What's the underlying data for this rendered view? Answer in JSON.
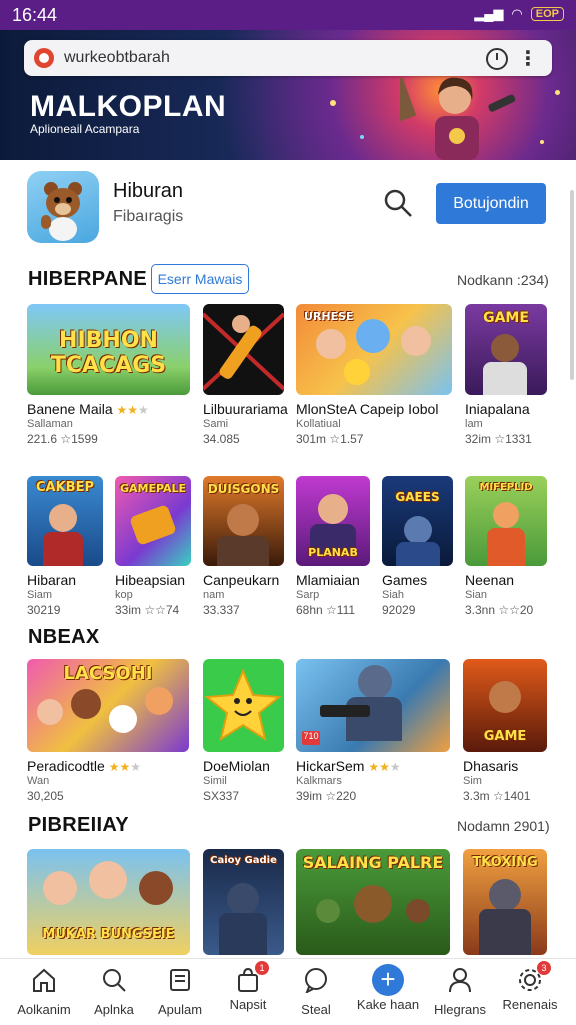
{
  "status": {
    "time": "16:44",
    "battery": "EOP"
  },
  "browser": {
    "url": "wurkeobtbarah"
  },
  "hero": {
    "brand": "MALKOPLAN",
    "tagline": "Aplioneail Acampara"
  },
  "app": {
    "title": "Hiburan",
    "subtitle": "Fibaıragis",
    "button_label": "Botujondin"
  },
  "sections": [
    {
      "title": "HIBERPANE",
      "chip": "Eserr Mawais",
      "more": "Nodkann :234)",
      "cards": [
        {
          "name": "Banene Maila",
          "dev": "Sallaman",
          "meta": "221.6 ☆1599",
          "stars": 2,
          "thumb_text": "HIBHON TCACAGS"
        },
        {
          "name": "Lilbuurariama",
          "dev": "Sami",
          "meta": "34.085",
          "stars": 0,
          "thumb_text": ""
        },
        {
          "name": "MlonSteA Capeip Iobol",
          "dev": "Kollatiual",
          "meta": "301m ☆1.57",
          "stars": 0,
          "thumb_text": "URHESE"
        },
        {
          "name": "Iniapalana",
          "dev": "lam",
          "meta": "32im ☆1331",
          "stars": 0,
          "thumb_text": "GAME"
        }
      ]
    },
    {
      "title": "",
      "chip": "",
      "more": "",
      "cards": [
        {
          "name": "Hibaran",
          "dev": "Siam",
          "meta": "30219",
          "stars": 0,
          "thumb_text": "CAKBEP"
        },
        {
          "name": "Hibeapsian",
          "dev": "kop",
          "meta": "33im ☆☆74",
          "stars": 0,
          "thumb_text": "GAMEPALE"
        },
        {
          "name": "Canpeukarn",
          "dev": "nam",
          "meta": "33.337",
          "stars": 0,
          "thumb_text": "DUISGONS"
        },
        {
          "name": "Mlamiaian",
          "dev": "Sarp",
          "meta": "68hn ☆111",
          "stars": 0,
          "thumb_text": "PLANAB"
        },
        {
          "name": "Games",
          "dev": "Siah",
          "meta": "92029",
          "stars": 0,
          "thumb_text": "GAEES"
        },
        {
          "name": "Neenan",
          "dev": "Sian",
          "meta": "3.3nn ☆☆20",
          "stars": 0,
          "thumb_text": "MIFEPLID"
        }
      ]
    },
    {
      "title": "NBEAX",
      "chip": "",
      "more": "",
      "cards": [
        {
          "name": "Peradicodtle",
          "dev": "Wan",
          "meta": "30,205",
          "stars": 2,
          "thumb_text": "LACSOHI"
        },
        {
          "name": "DoeMiolan",
          "dev": "Simil",
          "meta": "SX337",
          "stars": 0,
          "thumb_text": ""
        },
        {
          "name": "HickarSem",
          "dev": "Kalkmars",
          "meta": "39im ☆220",
          "stars": 2,
          "thumb_text": "710"
        },
        {
          "name": "Dhasaris",
          "dev": "Sim",
          "meta": "3.3m ☆1401",
          "stars": 0,
          "thumb_text": "GAME"
        }
      ]
    },
    {
      "title": "PIBREIIAY",
      "chip": "",
      "more": "Nodamn 2901)",
      "cards": [
        {
          "name": "",
          "dev": "",
          "meta": "",
          "stars": 0,
          "thumb_text": "MUKAR BUNGSEIE"
        },
        {
          "name": "",
          "dev": "",
          "meta": "",
          "stars": 0,
          "thumb_text": "Caioy Gadie"
        },
        {
          "name": "",
          "dev": "",
          "meta": "",
          "stars": 0,
          "thumb_text": "SALAING PALRE"
        },
        {
          "name": "",
          "dev": "",
          "meta": "",
          "stars": 0,
          "thumb_text": "TKOXING"
        }
      ]
    }
  ],
  "nav": [
    {
      "label": "Aolkanim",
      "icon": "home-icon",
      "badge": ""
    },
    {
      "label": "Aplnka",
      "icon": "search-icon",
      "badge": ""
    },
    {
      "label": "Apulam",
      "icon": "document-icon",
      "badge": ""
    },
    {
      "label": "Napsit",
      "icon": "bag-icon",
      "badge": "1"
    },
    {
      "label": "Steal",
      "icon": "chat-icon",
      "badge": ""
    },
    {
      "label": "Kake haan",
      "icon": "plus-icon",
      "badge": ""
    },
    {
      "label": "Hlegrans",
      "icon": "person-icon",
      "badge": ""
    },
    {
      "label": "Renenais",
      "icon": "gear-icon",
      "badge": "3"
    }
  ],
  "colors": {
    "status_bar": "#5b1e86",
    "accent": "#2f7ad8",
    "star": "#f2b01e"
  }
}
